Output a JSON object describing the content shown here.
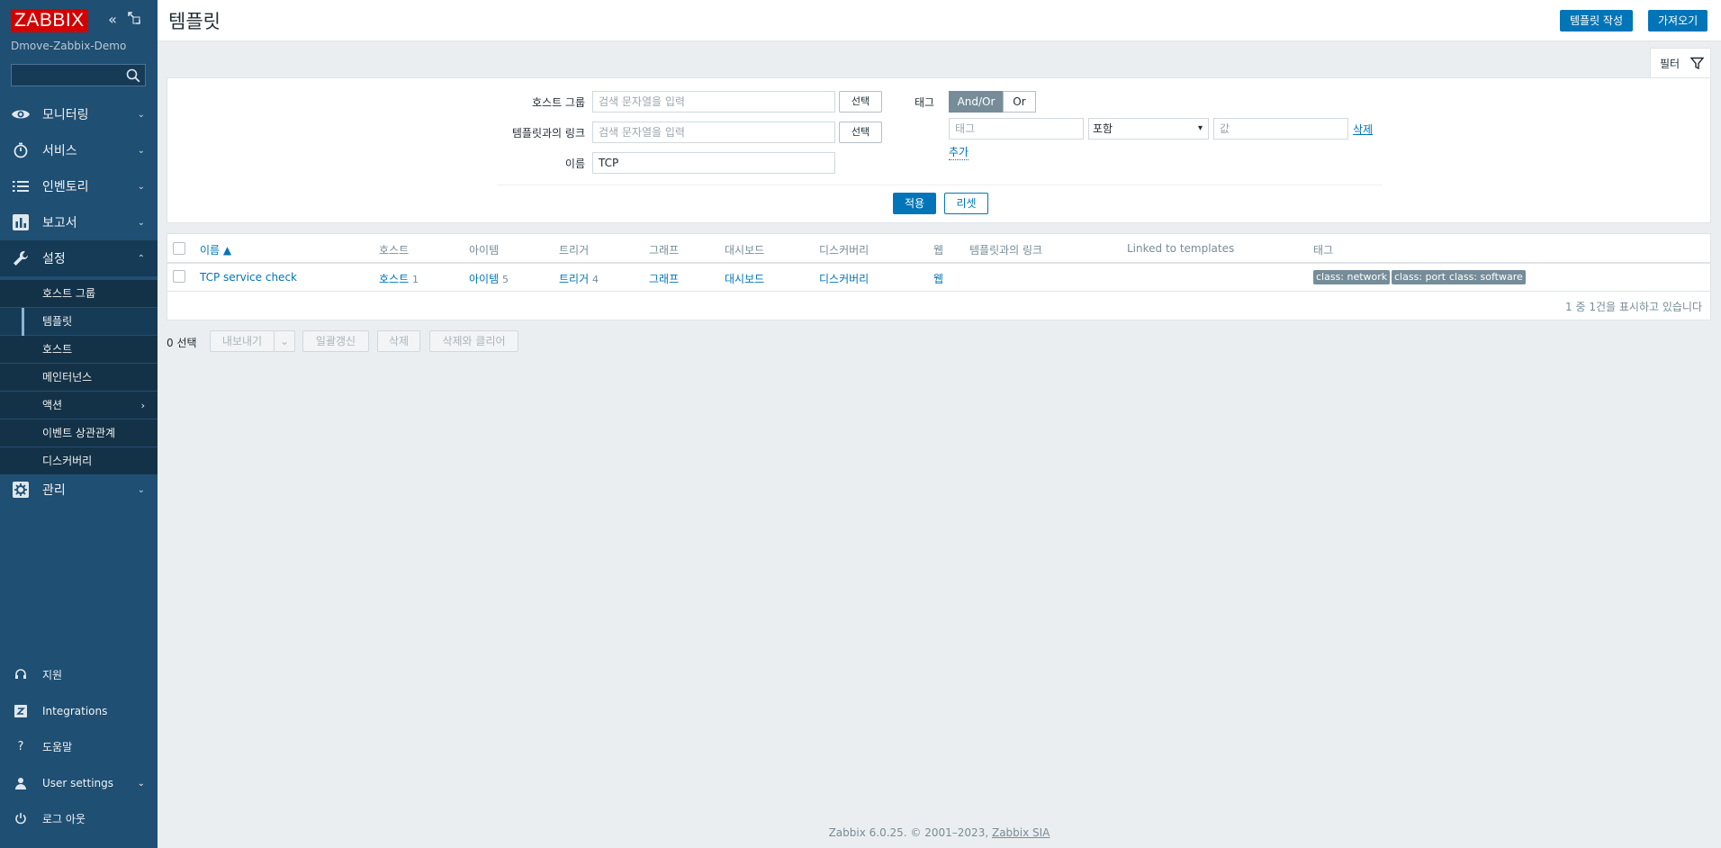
{
  "app": {
    "logo": "ZABBIX",
    "server_name": "Dmove-Zabbix-Demo"
  },
  "sidebar": {
    "search_placeholder": "",
    "menu": [
      {
        "label": "모니터링",
        "icon": "eye-icon"
      },
      {
        "label": "서비스",
        "icon": "stopwatch-icon"
      },
      {
        "label": "인벤토리",
        "icon": "list-icon"
      },
      {
        "label": "보고서",
        "icon": "bar-chart-icon"
      },
      {
        "label": "설정",
        "icon": "wrench-icon"
      },
      {
        "label": "관리",
        "icon": "gear-icon"
      }
    ],
    "config_submenu": [
      {
        "label": "호스트 그룹"
      },
      {
        "label": "템플릿"
      },
      {
        "label": "호스트"
      },
      {
        "label": "메인터넌스"
      },
      {
        "label": "액션"
      },
      {
        "label": "이벤트 상관관계"
      },
      {
        "label": "디스커버리"
      }
    ],
    "bottom": [
      {
        "label": "지원",
        "icon": "headset-icon"
      },
      {
        "label": "Integrations",
        "icon": "integrations-icon"
      },
      {
        "label": "도움말",
        "icon": "question-icon"
      },
      {
        "label": "User settings",
        "icon": "user-icon"
      },
      {
        "label": "로그 아웃",
        "icon": "power-icon"
      }
    ]
  },
  "header": {
    "title": "템플릿",
    "create_button": "템플릿 작성",
    "import_button": "가져오기"
  },
  "filter": {
    "tab_label": "필터",
    "host_group_label": "호스트 그룹",
    "host_group_placeholder": "검색 문자열을 입력",
    "linked_templates_label": "템플릿과의 링크",
    "linked_templates_placeholder": "검색 문자열을 입력",
    "select_button": "선택",
    "name_label": "이름",
    "name_value": "TCP",
    "tags_label": "태그",
    "tags_mode_andor": "And/Or",
    "tags_mode_or": "Or",
    "tag_placeholder": "태그",
    "tag_operator": "포함",
    "tag_value_placeholder": "값",
    "remove_link": "삭제",
    "add_link": "추가",
    "apply_button": "적용",
    "reset_button": "리셋"
  },
  "table": {
    "columns": {
      "name": "이름 ▲",
      "hosts": "호스트",
      "items": "아이템",
      "triggers": "트리거",
      "graphs": "그래프",
      "dashboards": "대시보드",
      "discovery": "디스커버리",
      "web": "웹",
      "linked_templates": "템플릿과의 링크",
      "linked_to_templates": "Linked to templates",
      "tags": "태그"
    },
    "rows": [
      {
        "name": "TCP service check",
        "hosts": "호스트",
        "hosts_count": "1",
        "items": "아이템",
        "items_count": "5",
        "triggers": "트리거",
        "triggers_count": "4",
        "graphs": "그래프",
        "dashboards": "대시보드",
        "discovery": "디스커버리",
        "web": "웹",
        "tags": [
          "class: network",
          "class: port",
          "class: software"
        ]
      }
    ],
    "paging": "1 중 1건을 표시하고 있습니다"
  },
  "actions": {
    "selected": "0 선택",
    "export": "내보내기",
    "mass_update": "일괄갱신",
    "delete": "삭제",
    "delete_clear": "삭제와 클리어"
  },
  "footer": {
    "text": "Zabbix 6.0.25. © 2001–2023,",
    "link": "Zabbix SIA"
  },
  "colors": {
    "sidebar": "#1f4f73",
    "accent": "#0275b8",
    "logo": "#d40000",
    "tag": "#768d99"
  }
}
